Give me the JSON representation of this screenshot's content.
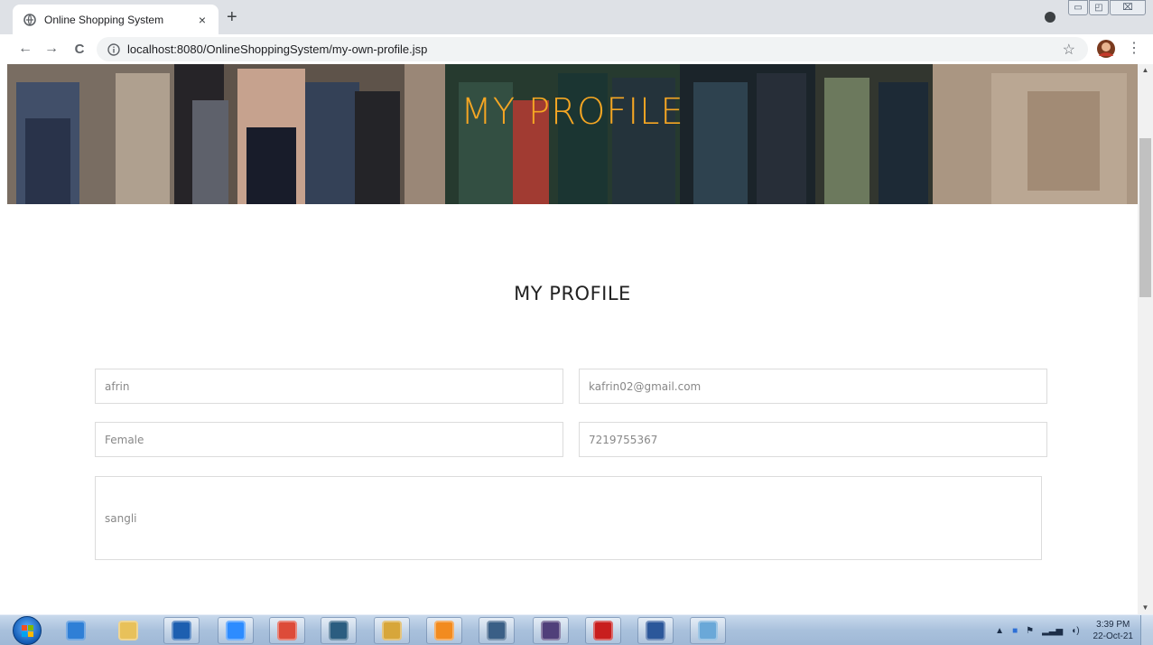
{
  "browser": {
    "tab_title": "Online Shopping System",
    "tab_close": "×",
    "new_tab": "+",
    "url": "localhost:8080/OnlineShoppingSystem/my-own-profile.jsp",
    "back": "←",
    "forward": "→",
    "reload": "C",
    "star": "☆",
    "menu": "⋮",
    "window_buttons": {
      "minimize": "▭",
      "restore": "◰",
      "close": "⌧"
    }
  },
  "page": {
    "hero_title": "MY PROFILE",
    "section_title": "MY PROFILE",
    "fields": {
      "name": "afrin",
      "email": "kafrin02@gmail.com",
      "gender": "Female",
      "phone": "7219755367",
      "address": "sangli"
    }
  },
  "taskbar": {
    "apps": [
      {
        "icon": "internet-explorer-icon",
        "color": "#2f7fd6"
      },
      {
        "icon": "file-explorer-icon",
        "color": "#e8c15a"
      },
      {
        "icon": "media-player-icon",
        "color": "#1d5fb0"
      },
      {
        "icon": "zoom-icon",
        "color": "#2d8cff"
      },
      {
        "icon": "chrome-icon",
        "color": "#dd4b39"
      },
      {
        "icon": "mysql-workbench-icon",
        "color": "#2b5d80"
      },
      {
        "icon": "lock-app-icon",
        "color": "#d7a63a"
      },
      {
        "icon": "sublime-text-icon",
        "color": "#f28b1f"
      },
      {
        "icon": "window-app-icon",
        "color": "#3a5f86"
      },
      {
        "icon": "java-ee-ide-icon",
        "color": "#503f7a"
      },
      {
        "icon": "acrobat-reader-icon",
        "color": "#c81e1e"
      },
      {
        "icon": "word-icon",
        "color": "#2b579a"
      },
      {
        "icon": "paint-icon",
        "color": "#6aa8d8"
      }
    ],
    "time": "3:39 PM",
    "date": "22-Oct-21"
  },
  "colors": {
    "hero_title": "#f5a623",
    "field_border": "#dcdcdc",
    "field_text": "#888888"
  }
}
